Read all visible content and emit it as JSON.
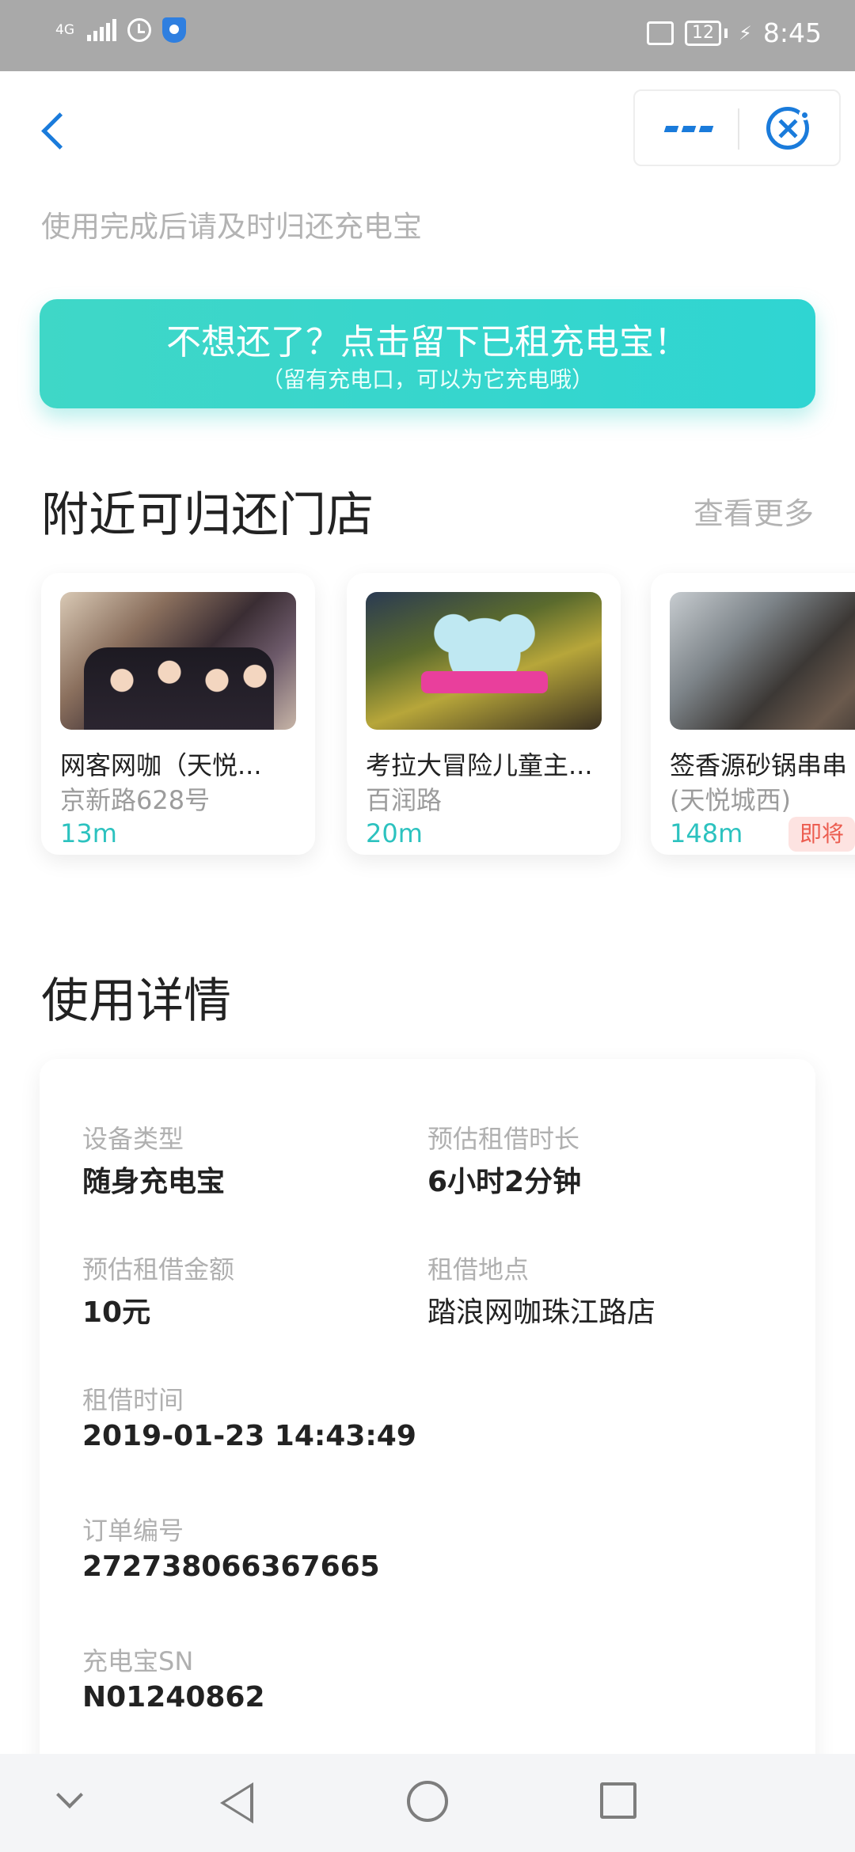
{
  "status_bar": {
    "network": "4G",
    "battery": "12",
    "time": "8:45",
    "icons": [
      "signal-icon",
      "alarm-icon",
      "shield-icon",
      "vibrate-icon",
      "battery-icon",
      "charging-icon"
    ]
  },
  "header": {
    "back_icon": "back-arrow-icon",
    "more_icon": "more-dots-icon",
    "close_icon": "close-mini-program-icon",
    "accent_color": "#1a7bdb"
  },
  "hint": "使用完成后请及时归还充电宝",
  "keep_banner": {
    "title": "不想还了？点击留下已租充电宝！",
    "subtitle": "（留有充电口，可以为它充电哦）",
    "color": "#3fd7c7"
  },
  "nearby": {
    "title": "附近可归还门店",
    "more": "查看更多",
    "stores": [
      {
        "name": "网客网咖（天悦...",
        "address": "京新路628号",
        "distance": "13m"
      },
      {
        "name": "考拉大冒险儿童主...",
        "address": "百润路",
        "distance": "20m"
      },
      {
        "name": "签香源砂锅串串",
        "address": "(天悦城西)",
        "distance": "148m",
        "tag": "即将"
      }
    ]
  },
  "details": {
    "title": "使用详情",
    "fields": [
      {
        "label": "设备类型",
        "value": "随身充电宝"
      },
      {
        "label": "预估租借时长",
        "value": "6小时2分钟"
      },
      {
        "label": "预估租借金额",
        "value": "10元"
      },
      {
        "label": "租借地点",
        "value": "踏浪网咖珠江路店"
      },
      {
        "label": "租借时间",
        "value": "2019-01-23 14:43:49"
      },
      {
        "label": "订单编号",
        "value": "272738066367665"
      },
      {
        "label": "充电宝SN",
        "value": "N01240862"
      }
    ]
  },
  "nav_bar": {
    "icons": [
      "collapse-icon",
      "nav-back-icon",
      "nav-home-icon",
      "nav-recents-icon"
    ]
  }
}
